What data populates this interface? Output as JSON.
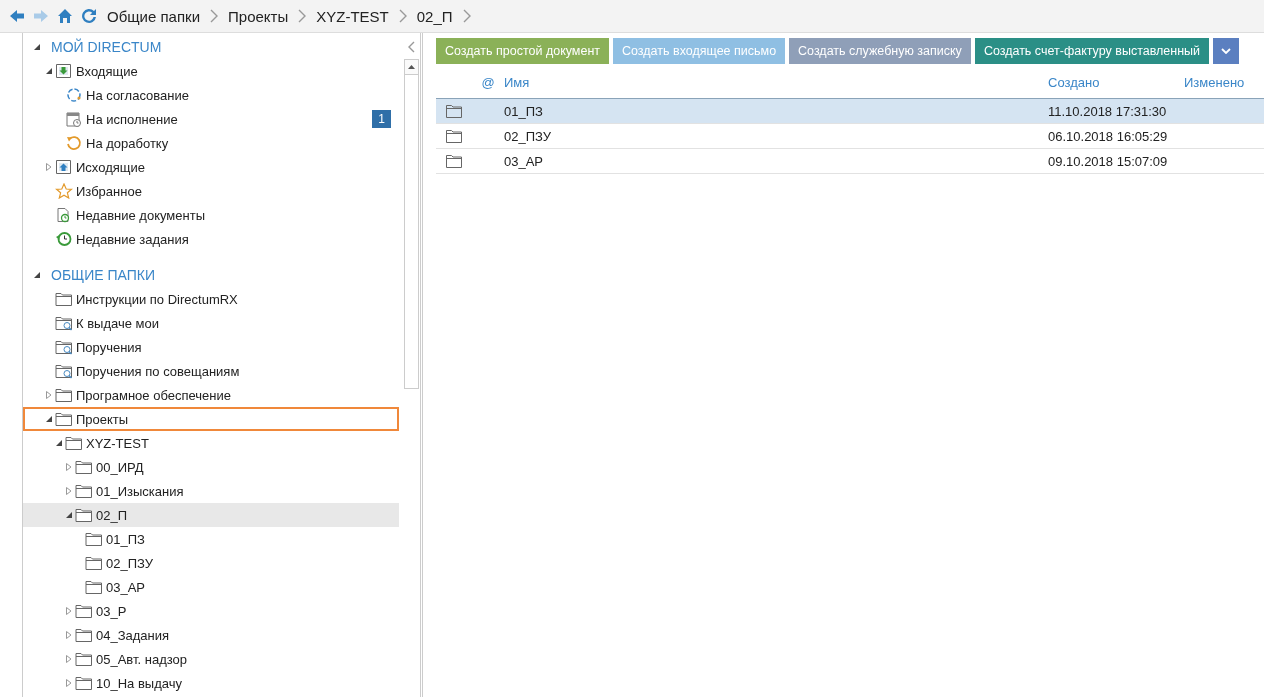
{
  "nav_buttons": [
    {
      "kind": "back",
      "disabled": false
    },
    {
      "kind": "forward",
      "disabled": true
    },
    {
      "kind": "home",
      "disabled": false
    },
    {
      "kind": "refresh",
      "disabled": false
    }
  ],
  "breadcrumb": [
    "Общие папки",
    "Проекты",
    "XYZ-TEST",
    "02_П"
  ],
  "sections": [
    {
      "title": "МОЙ DIRECTUM",
      "expanded": true,
      "items": [
        {
          "label": "Входящие",
          "kind": "inbox",
          "expanded": true,
          "selected": false,
          "focused": false,
          "children": [
            {
              "label": "На согласование",
              "kind": "sync",
              "selected": false,
              "focused": false
            },
            {
              "label": "На исполнение",
              "kind": "calendar",
              "badge": "1",
              "selected": false,
              "focused": false
            },
            {
              "label": "На доработку",
              "kind": "undo",
              "selected": false,
              "focused": false
            }
          ]
        },
        {
          "label": "Исходящие",
          "kind": "outbox",
          "expanded": false,
          "selected": false,
          "focused": false
        },
        {
          "label": "Избранное",
          "kind": "star",
          "selected": false,
          "focused": false
        },
        {
          "label": "Недавние документы",
          "kind": "recent",
          "selected": false,
          "focused": false
        },
        {
          "label": "Недавние задания",
          "kind": "history",
          "selected": false,
          "focused": false
        }
      ]
    },
    {
      "title": "ОБЩИЕ ПАПКИ",
      "expanded": true,
      "items": [
        {
          "label": "Инструкции по DirectumRX",
          "kind": "folder",
          "selected": false,
          "focused": false
        },
        {
          "label": "К выдаче мои",
          "kind": "search",
          "selected": false,
          "focused": false
        },
        {
          "label": "Поручения",
          "kind": "search",
          "selected": false,
          "focused": false
        },
        {
          "label": "Поручения по совещаниям",
          "kind": "search",
          "selected": false,
          "focused": false
        },
        {
          "label": "Програмное обеспечение",
          "kind": "folder",
          "expanded": false,
          "selected": false,
          "focused": false
        },
        {
          "label": "Проекты",
          "kind": "folder",
          "expanded": true,
          "selected": false,
          "focused": true,
          "children": [
            {
              "label": "XYZ-TEST",
              "kind": "folder",
              "expanded": true,
              "selected": false,
              "focused": false,
              "children": [
                {
                  "label": "00_ИРД",
                  "kind": "folder",
                  "expanded": false,
                  "selected": false,
                  "focused": false
                },
                {
                  "label": "01_Изыскания",
                  "kind": "folder",
                  "expanded": false,
                  "selected": false,
                  "focused": false
                },
                {
                  "label": "02_П",
                  "kind": "folder",
                  "expanded": true,
                  "selected": true,
                  "focused": false,
                  "children": [
                    {
                      "label": "01_ПЗ",
                      "kind": "folder",
                      "selected": false,
                      "focused": false
                    },
                    {
                      "label": "02_ПЗУ",
                      "kind": "folder",
                      "selected": false,
                      "focused": false
                    },
                    {
                      "label": "03_АР",
                      "kind": "folder",
                      "selected": false,
                      "focused": false
                    }
                  ]
                },
                {
                  "label": "03_Р",
                  "kind": "folder",
                  "expanded": false,
                  "selected": false,
                  "focused": false
                },
                {
                  "label": "04_Задания",
                  "kind": "folder",
                  "expanded": false,
                  "selected": false,
                  "focused": false
                },
                {
                  "label": "05_Авт. надзор",
                  "kind": "folder",
                  "expanded": false,
                  "selected": false,
                  "focused": false
                },
                {
                  "label": "10_На выдачу",
                  "kind": "folder",
                  "expanded": false,
                  "selected": false,
                  "focused": false
                }
              ]
            }
          ]
        }
      ]
    }
  ],
  "action_buttons": [
    {
      "label": "Создать простой документ",
      "color": "#8bb158"
    },
    {
      "label": "Создать входящее письмо",
      "color": "#8fbfe3"
    },
    {
      "label": "Создать служебную записку",
      "color": "#8f9fb8"
    },
    {
      "label": "Создать счет-фактуру выставленный",
      "color": "#2b8f86"
    }
  ],
  "table": {
    "columns": [
      "@",
      "Имя",
      "Создано",
      "Изменено"
    ],
    "rows": [
      {
        "name": "01_ПЗ",
        "created": "11.10.2018 17:31:30",
        "selected": true
      },
      {
        "name": "02_ПЗУ",
        "created": "06.10.2018 16:05:29",
        "selected": false
      },
      {
        "name": "03_АР",
        "created": "09.10.2018 15:07:09",
        "selected": false
      }
    ]
  }
}
